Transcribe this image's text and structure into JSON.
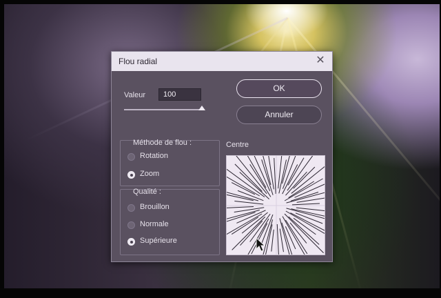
{
  "dialog": {
    "title": "Flou radial",
    "close_icon": "close-icon",
    "value_label": "Valeur",
    "value": "100",
    "slider_level_percent": 100,
    "ok_label": "OK",
    "cancel_label": "Annuler",
    "method_title": "Méthode de flou :",
    "method_options": [
      "Rotation",
      "Zoom"
    ],
    "method_selected": "Zoom",
    "quality_title": "Qualité :",
    "quality_options": [
      "Brouillon",
      "Normale",
      "Supérieure"
    ],
    "quality_selected": "Supérieure",
    "center_label": "Centre"
  },
  "colors": {
    "dialog_bg": "#5a5160",
    "titlebar_bg": "#e9e4ee",
    "preview_bg": "#efe8f2"
  }
}
